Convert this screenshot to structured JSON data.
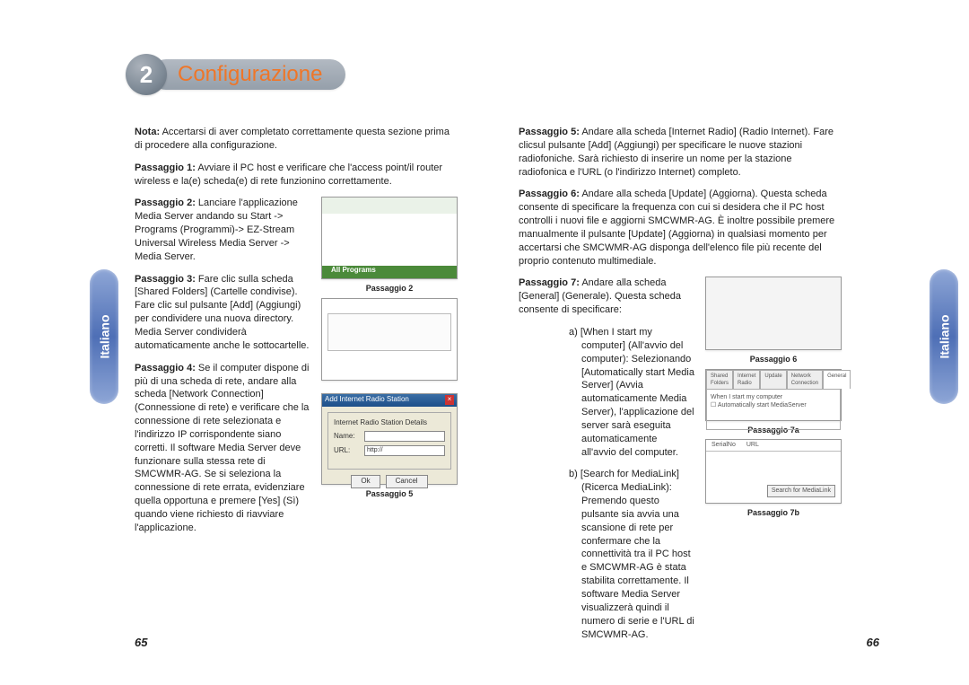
{
  "chapter": {
    "number": "2",
    "title": "Configurazione"
  },
  "sideTab": "Italiano",
  "left": {
    "nota": "Nota:  Accertarsi di aver completato correttamente questa sezione prima di procedere alla configurazione.",
    "p1_label": "Passaggio 1:",
    "p1": "Avviare il PC host e verificare che l'access point/il router wireless e la(e) scheda(e) di rete funzionino correttamente.",
    "p2_label": "Passaggio 2:",
    "p2": "Lanciare l'applicazione Media Server andando su Start -> Programs (Programmi)-> EZ-Stream Universal Wireless Media Server -> Media Server.",
    "p3_label": "Passaggio 3:",
    "p3": "Fare clic sulla scheda [Shared Folders] (Cartelle condivise). Fare clic sul pulsante [Add] (Aggiungi) per condividere una nuova directory. Media Server condividerà automaticamente anche le sottocartelle.",
    "p4_label": "Passaggio 4:",
    "p4": "Se il computer dispone di più di una scheda di rete, andare alla scheda [Network Connection] (Connessione di rete) e verificare che la connessione di rete selezionata e l'indirizzo IP corrispondente siano corretti. Il software Media Server deve funzionare sulla stessa rete di SMCWMR-AG. Se si seleziona la connessione di rete errata, evidenziare quella opportuna e premere [Yes] (Sì) quando viene richiesto di riavviare l'applicazione.",
    "fig2_cap": "Passaggio 2",
    "fig5_cap": "Passaggio 5",
    "dlg_title": "Add Internet Radio Station",
    "dlg_group": "Internet Radio Station Details",
    "dlg_name": "Name:",
    "dlg_url": "URL:",
    "dlg_url_val": "http://",
    "dlg_ok": "Ok",
    "dlg_cancel": "Cancel",
    "pagenum": "65"
  },
  "right": {
    "p5_label": "Passaggio 5:",
    "p5": "Andare alla scheda [Internet Radio] (Radio Internet). Fare clicsul pulsante [Add] (Aggiungi) per specificare le nuove stazioni radiofoniche. Sarà richiesto di inserire un nome per la stazione radiofonica e l'URL (o l'indirizzo Internet) completo.",
    "p6_label": "Passaggio 6:",
    "p6": "Andare alla scheda [Update] (Aggiorna). Questa scheda consente di specificare la frequenza con cui si desidera che il PC host controlli i nuovi file e  aggiorni SMCWMR-AG. È inoltre possibile premere manualmente il pulsante [Update] (Aggiorna) in qualsiasi momento per accertarsi che SMCWMR-AG disponga dell'elenco file più recente del proprio contenuto multimediale.",
    "p7_label": "Passaggio 7:",
    "p7": "Andare alla scheda [General] (Generale). Questa scheda consente di specificare:",
    "p7a": "a)  [When I start my computer] (All'avvio del computer): Selezionando [Automatically start Media Server] (Avvia automaticamente Media Server), l'applicazione del server sarà eseguita automaticamente all'avvio del computer.",
    "p7b": "b)  [Search for MediaLink] (Ricerca MediaLink): Premendo questo pulsante sia avvia una scansione di rete per confermare che la connettività tra il PC host e SMCWMR-AG è stata stabilita correttamente. Il software Media Server visualizzerà quindi il numero di serie e l'URL di SMCWMR-AG.",
    "fig6_cap": "Passaggio 6",
    "fig7a_cap": "Passaggio 7a",
    "fig7b_cap": "Passaggio 7b",
    "tab_general": "General",
    "tab_body_line": "When I start my computer",
    "tab_body_cb": "Automatically start MediaServer",
    "search_hdr1": "SerialNo",
    "search_hdr2": "URL",
    "search_btn": "Search for MediaLink",
    "pagenum": "66"
  }
}
